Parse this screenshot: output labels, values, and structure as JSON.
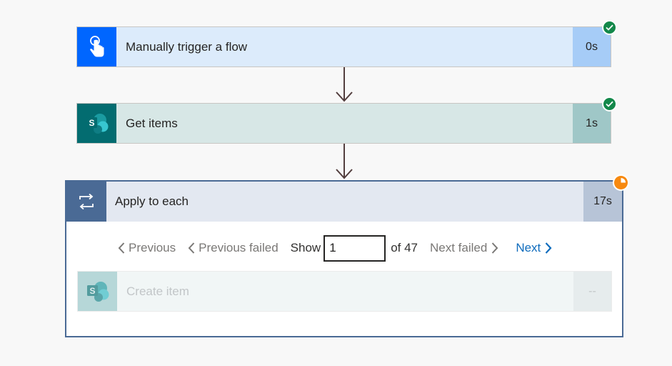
{
  "colors": {
    "trigger_accent": "#0066ff",
    "sharepoint_accent": "#036c70",
    "loop_accent": "#4a6a95",
    "success": "#13884a",
    "running": "#f7890f",
    "link": "#0f6cbd"
  },
  "steps": [
    {
      "title": "Manually trigger a flow",
      "duration": "0s",
      "icon": "touch-hand-icon",
      "status": "success"
    },
    {
      "title": "Get items",
      "duration": "1s",
      "icon": "sharepoint-icon",
      "status": "success"
    }
  ],
  "loop": {
    "title": "Apply to each",
    "duration": "17s",
    "icon": "loop-icon",
    "status": "running",
    "pager": {
      "previous": "Previous",
      "previous_failed": "Previous failed",
      "show": "Show",
      "current_page": "1",
      "of": "of 47",
      "next_failed": "Next failed",
      "next": "Next"
    },
    "inner_step": {
      "title": "Create item",
      "duration": "--",
      "icon": "sharepoint-icon"
    }
  }
}
